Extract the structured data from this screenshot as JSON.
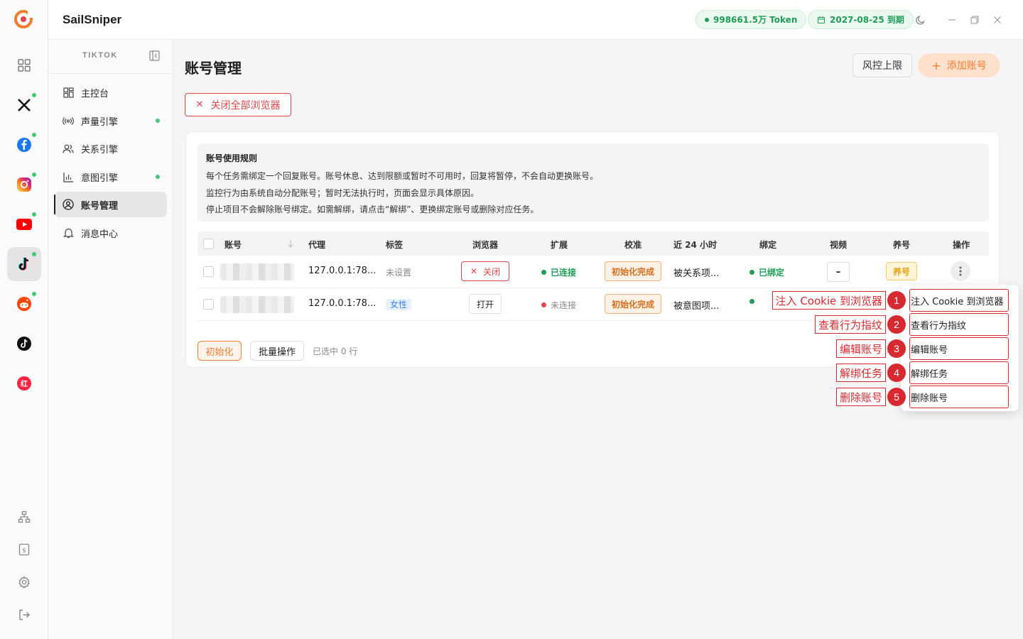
{
  "app": {
    "title": "SailSniper"
  },
  "topbar": {
    "token_label": "998661.5万 Token",
    "expiry_label": "2027-08-25 到期"
  },
  "rail": {
    "items": [
      {
        "icon": "grid-icon",
        "dot": false
      },
      {
        "icon": "x-icon",
        "dot": true
      },
      {
        "icon": "facebook-icon",
        "dot": true
      },
      {
        "icon": "instagram-icon",
        "dot": true
      },
      {
        "icon": "youtube-icon",
        "dot": true
      },
      {
        "icon": "tiktok-icon",
        "dot": true,
        "active": true
      },
      {
        "icon": "reddit-icon",
        "dot": true
      },
      {
        "icon": "tiktok-alt-icon",
        "dot": false
      },
      {
        "icon": "xiaohongshu-icon",
        "dot": false
      }
    ],
    "bottom": [
      "org-chart-icon",
      "billing-icon",
      "settings-icon",
      "logout-icon"
    ]
  },
  "sidebar": {
    "header": "TIKTOK",
    "items": [
      {
        "label": "主控台",
        "icon": "dashboard-icon",
        "dot": false
      },
      {
        "label": "声量引擎",
        "icon": "broadcast-icon",
        "dot": true
      },
      {
        "label": "关系引擎",
        "icon": "users-icon",
        "dot": false
      },
      {
        "label": "意图引擎",
        "icon": "bar-chart-icon",
        "dot": true
      },
      {
        "label": "账号管理",
        "icon": "account-icon",
        "dot": false,
        "active": true
      },
      {
        "label": "消息中心",
        "icon": "bell-icon",
        "dot": false
      }
    ]
  },
  "main": {
    "title": "账号管理",
    "risk_button": "风控上限",
    "add_button": "添加账号",
    "close_all_button": "关闭全部浏览器",
    "rules": {
      "title": "账号使用规则",
      "lines": [
        "每个任务需绑定一个回复账号。账号休息、达到限额或暂时不可用时，回复将暂停，不会自动更换账号。",
        "监控行为由系统自动分配账号；暂时无法执行时，页面会显示具体原因。",
        "停止项目不会解除账号绑定。如需解绑，请点击“解绑”、更换绑定账号或删除对应任务。"
      ]
    },
    "table": {
      "headers": [
        "账号",
        "代理",
        "标签",
        "浏览器",
        "扩展",
        "校准",
        "近 24 小时",
        "绑定",
        "视频",
        "养号",
        "操作"
      ],
      "rows": [
        {
          "proxy": "127.0.0.1:78...",
          "tag": "未设置",
          "browser": "关闭",
          "extension": "已连接",
          "calibration": "初始化完成",
          "last24h": "被关系项...",
          "binding": "已绑定",
          "video": "–",
          "nurture": "养号"
        },
        {
          "proxy": "127.0.0.1:78...",
          "tag": "女性",
          "browser": "打开",
          "extension": "未连接",
          "calibration": "初始化完成",
          "last24h": "被意图项..."
        }
      ]
    },
    "footer": {
      "init_button": "初始化",
      "batch_button": "批量操作",
      "selected": "已选中 0 行"
    }
  },
  "menu": {
    "items": [
      {
        "n": "1",
        "label": "注入 Cookie 到浏览器"
      },
      {
        "n": "2",
        "label": "查看行为指纹"
      },
      {
        "n": "3",
        "label": "编辑账号"
      },
      {
        "n": "4",
        "label": "解绑任务"
      },
      {
        "n": "5",
        "label": "删除账号"
      }
    ]
  },
  "colors": {
    "accent": "#f07d2e",
    "danger": "#e0464a",
    "success": "#1f9d55",
    "annotation": "#d72a30"
  }
}
